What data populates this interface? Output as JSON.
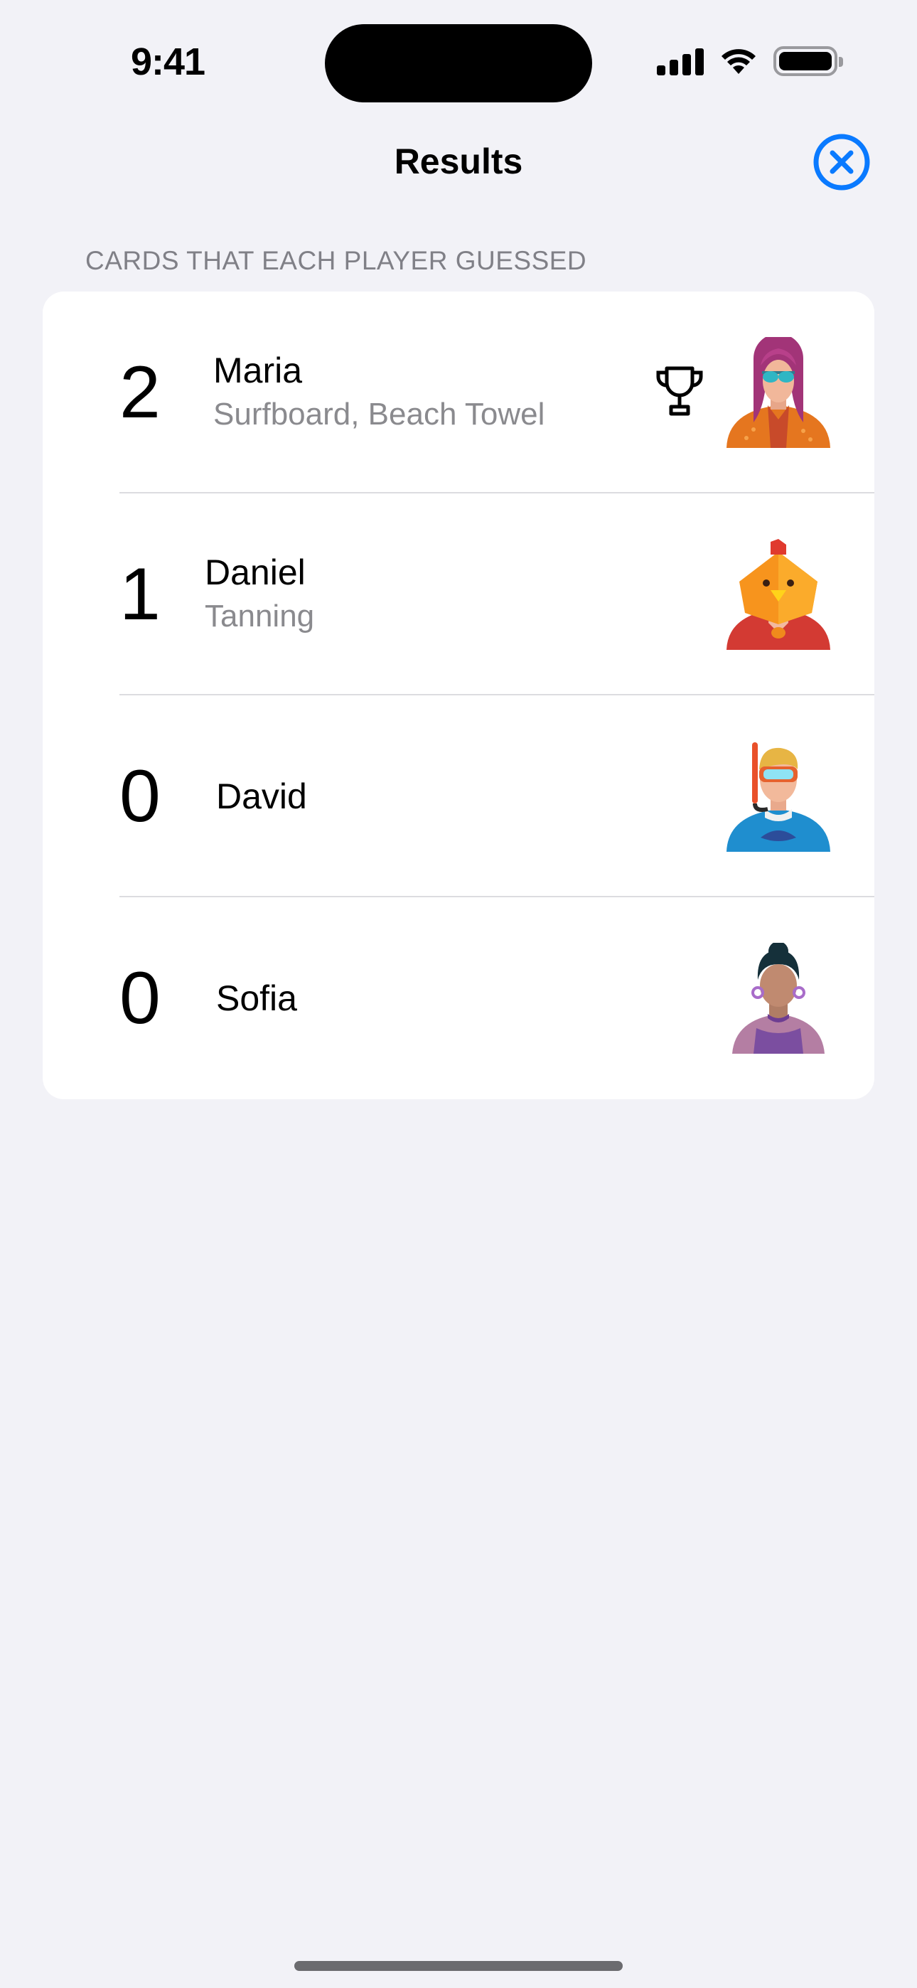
{
  "status_bar": {
    "time": "9:41"
  },
  "nav": {
    "title": "Results",
    "close_icon": "xmark-circle-icon",
    "accent": "#0a7aff"
  },
  "section": {
    "header": "CARDS THAT EACH PLAYER GUESSED"
  },
  "players": [
    {
      "score": "2",
      "name": "Maria",
      "cards": "Surfboard, Beach Towel",
      "winner": true,
      "avatar": "woman-sunglasses-avatar"
    },
    {
      "score": "1",
      "name": "Daniel",
      "cards": "Tanning",
      "winner": false,
      "avatar": "chicken-costume-avatar"
    },
    {
      "score": "0",
      "name": "David",
      "cards": "",
      "winner": false,
      "avatar": "snorkel-diver-avatar"
    },
    {
      "score": "0",
      "name": "Sofia",
      "cards": "",
      "winner": false,
      "avatar": "woman-earrings-avatar"
    }
  ]
}
